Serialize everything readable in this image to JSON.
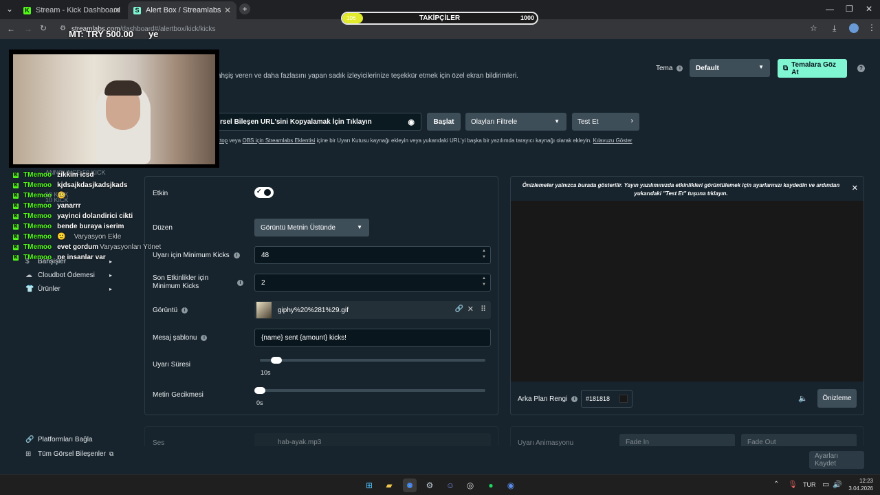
{
  "browser": {
    "tabs": [
      {
        "label": "Stream - Kick Dashboard",
        "icon": "K"
      },
      {
        "label": "Alert Box / Streamlabs",
        "icon": "S"
      }
    ],
    "url_host": "streamlabs.com",
    "url_path": "/dashboard#/alertbox/kick/kicks"
  },
  "overlay": {
    "followers_label": "TAKİPÇİLER",
    "followers_current": "106",
    "followers_goal": "1000",
    "followers_progress": 0.106,
    "donation_text": "MT: TRY 500.00",
    "donation_extra": "ye"
  },
  "chat": [
    {
      "user": "TMemoo",
      "msg": "zikkim icsd"
    },
    {
      "user": "TMemoo",
      "msg": "kjdsajkdasjkadsjkads"
    },
    {
      "user": "TMemoo",
      "msg": "🙂"
    },
    {
      "user": "TMemoo",
      "msg": "yanarrr"
    },
    {
      "user": "TMemoo",
      "msg": "yayinci dolandirici cikti"
    },
    {
      "user": "TMemoo",
      "msg": "bende buraya iserim"
    },
    {
      "user": "TMemoo",
      "msg": "🙂"
    },
    {
      "user": "TMemoo",
      "msg": "evet gordum"
    },
    {
      "user": "TMemoo",
      "msg": "ne insanlar var"
    }
  ],
  "sidebar": {
    "ghost_items": [
      "ANNOUNCE 50 KICK",
      "10 KICK",
      "10 KICK",
      "Varyasyon Ekle",
      "Varyasyonları Yönet"
    ],
    "items": [
      {
        "label": "Bahşişler"
      },
      {
        "label": "Cloudbot Ödemesi"
      },
      {
        "label": "Ürünler"
      }
    ],
    "bottom": [
      {
        "label": "Platformları Bağla"
      },
      {
        "label": "Tüm Görsel Bileşenler"
      }
    ]
  },
  "header": {
    "description": "ahşiş veren ve daha fazlasını yapan sadık izleyicilerinize teşekkür etmek için özel ekran bildirimleri.",
    "theme_label": "Tema",
    "theme_value": "Default",
    "browse_themes": "Temalara Göz At"
  },
  "toolbar": {
    "copy_url": "rsel Bileşen URL'sini Kopyalamak İçin Tıklayın",
    "start": "Başlat",
    "filter": "Olayları Filtrele",
    "test": "Test Et",
    "help_prefix": "ktop",
    "help_mid1": " veya ",
    "help_link1": "OBS için Streamlabs Eklentisi",
    "help_mid2": " içine bir Uyarı Kutusu kaynağı ekleyin veya yukarıdaki URL'yi başka bir yazılımda tarayıcı kaynağı olarak ekleyin. ",
    "help_link2": "Kılavuzu Göster"
  },
  "settings": {
    "enabled_label": "Etkin",
    "enabled": true,
    "layout_label": "Düzen",
    "layout_value": "Görüntü Metnin Üstünde",
    "min_kicks_label": "Uyarı için Minimum Kicks",
    "min_kicks_value": "48",
    "recent_min_label": "Son Etkinlikler için Minimum Kicks",
    "recent_min_value": "2",
    "image_label": "Görüntü",
    "image_value": "giphy%20%281%29.gif",
    "template_label": "Mesaj şablonu",
    "template_value": "{name} sent {amount} kicks!",
    "duration_label": "Uyarı Süresi",
    "duration_value": "10s",
    "duration_fraction": 0.05,
    "delay_label": "Metin Gecikmesi",
    "delay_value": "0s",
    "delay_fraction": 0.0,
    "sound_label": "Ses",
    "sound_value": "hab-ayak.mp3"
  },
  "preview": {
    "notice": "Önizlemeler yalnızca burada gösterilir. Yayın yazılımınızda etkinlikleri görüntülemek için ayarlarınızı kaydedin ve ardından yukarıdaki \"Test Et\" tuşuna tıklayın.",
    "bg_color_label": "Arka Plan Rengi",
    "bg_color_value": "#181818",
    "preview_button": "Önizleme",
    "animation_label": "Uyarı Animasyonu",
    "anim_in": "Fade In",
    "anim_out": "Fade Out",
    "save_button": "Ayarları Kaydet"
  },
  "taskbar": {
    "lang": "TUR",
    "time": "12:23",
    "date": "3.04.2026"
  },
  "colors": {
    "accent": "#53fc18",
    "teal_button": "#80f5d2",
    "page_bg": "#17242d"
  }
}
